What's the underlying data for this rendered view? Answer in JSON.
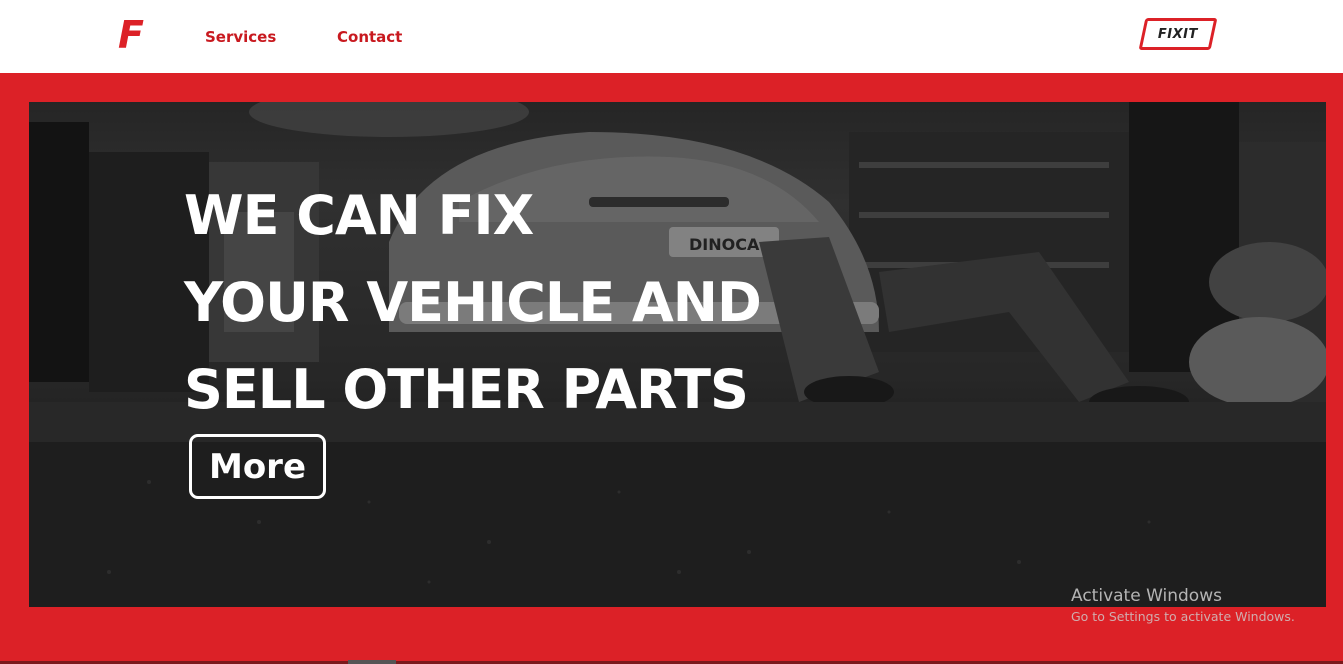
{
  "navbar": {
    "logo_letter": "F",
    "links": [
      {
        "label": "Services"
      },
      {
        "label": "Contact"
      }
    ],
    "brand": "FIXIT"
  },
  "hero": {
    "headline_lines": [
      "WE CAN FIX",
      "YOUR VEHICLE AND",
      "SELL OTHER PARTS"
    ],
    "cta_label": "More",
    "plate_text": "DINOCA"
  },
  "watermark": {
    "title": "Activate Windows",
    "subtitle": "Go to Settings to activate Windows."
  },
  "colors": {
    "brand_red": "#dc2127",
    "nav_link": "#c8191f",
    "background_white": "#ffffff"
  }
}
